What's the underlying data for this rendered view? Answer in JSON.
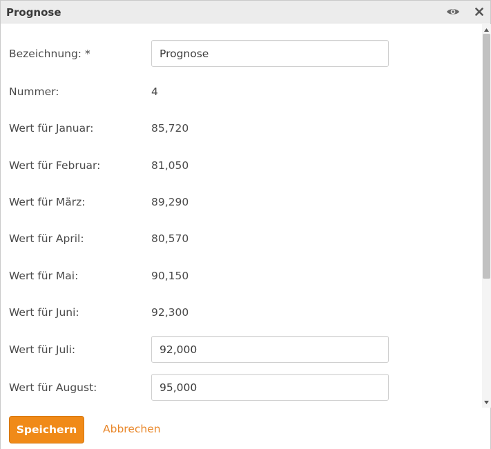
{
  "dialog": {
    "title": "Prognose"
  },
  "icons": {
    "eye": "eye-icon",
    "close": "close-icon"
  },
  "form": {
    "bezeichnung": {
      "label": "Bezeichnung: *",
      "value": "Prognose"
    },
    "nummer": {
      "label": "Nummer:",
      "value": "4"
    },
    "januar": {
      "label": "Wert für Januar:",
      "value": "85,720"
    },
    "februar": {
      "label": "Wert für Februar:",
      "value": "81,050"
    },
    "maerz": {
      "label": "Wert für März:",
      "value": "89,290"
    },
    "april": {
      "label": "Wert für April:",
      "value": "80,570"
    },
    "mai": {
      "label": "Wert für Mai:",
      "value": "90,150"
    },
    "juni": {
      "label": "Wert für Juni:",
      "value": "92,300"
    },
    "juli": {
      "label": "Wert für Juli:",
      "value": "92,000"
    },
    "august": {
      "label": "Wert für August:",
      "value": "95,000"
    }
  },
  "footer": {
    "save_label": "Speichern",
    "cancel_label": "Abbrechen"
  },
  "colors": {
    "accent": "#f08a18",
    "link": "#e9872a",
    "titlebar": "#ececec"
  }
}
